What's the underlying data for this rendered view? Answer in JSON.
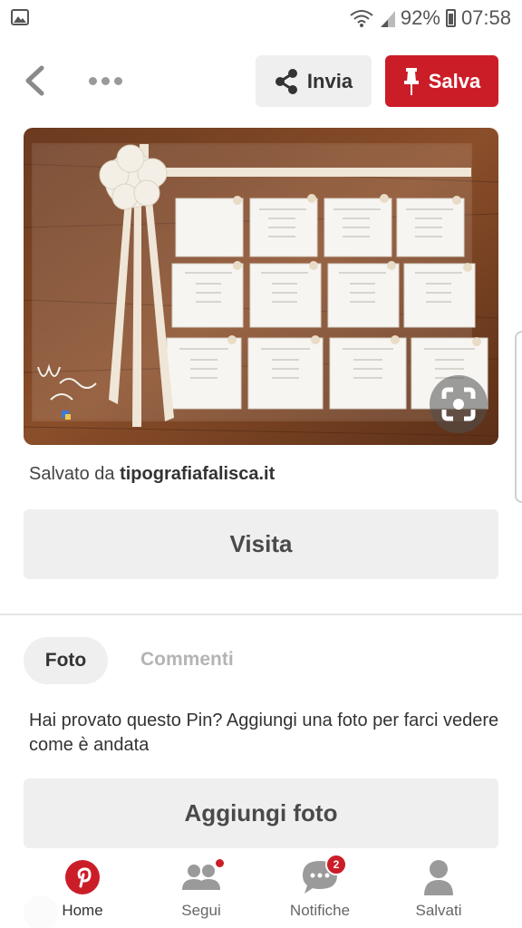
{
  "status_bar": {
    "battery": "92%",
    "time": "07:58",
    "icons": [
      "image-notification-icon",
      "wifi-icon",
      "signal-icon",
      "battery-icon"
    ]
  },
  "topbar": {
    "back_icon": "chevron-left-icon",
    "more_icon": "more-dots-icon",
    "send_label": "Invia",
    "save_label": "Salva"
  },
  "pin": {
    "image_desc_icon": "visual-search-icon"
  },
  "saved_from": {
    "prefix": "Salvato da",
    "source": "tipografiafalisca.it"
  },
  "visit_label": "Visita",
  "tabs": {
    "photo": "Foto",
    "comments": "Commenti"
  },
  "prompt": "Hai provato questo Pin? Aggiungi una foto per farci vedere come è andata",
  "add_photo_label": "Aggiungi foto",
  "nav": {
    "items": [
      {
        "label": "Home",
        "icon": "pinterest-logo-icon"
      },
      {
        "label": "Segui",
        "icon": "people-icon"
      },
      {
        "label": "Notifiche",
        "icon": "chat-bubble-icon",
        "badge": "2"
      },
      {
        "label": "Salvati",
        "icon": "profile-icon"
      }
    ]
  },
  "colors": {
    "brand_red": "#cb1d28",
    "button_grey": "#efefef"
  }
}
